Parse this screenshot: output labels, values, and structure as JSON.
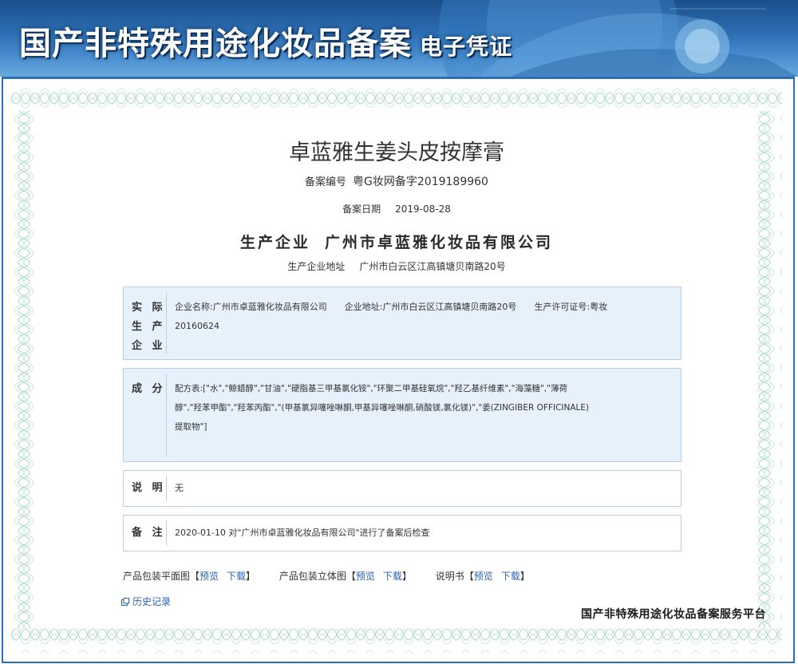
{
  "banner": {
    "title": "国产非特殊用途化妆品备案",
    "subtitle": "电子凭证"
  },
  "product": {
    "name": "卓蓝雅生姜头皮按摩膏",
    "record_no_label": "备案编号",
    "record_no": "粤G妆网备字2019189960",
    "record_date_label": "备案日期",
    "record_date": "2019-08-28",
    "producer_label": "生产企业",
    "producer": "广州市卓蓝雅化妆品有限公司",
    "producer_addr_label": "生产企业地址",
    "producer_addr": "广州市白云区江高镇塘贝南路20号"
  },
  "actual_producer": {
    "label": "实际生产企业",
    "label_lines": [
      "实 际",
      "生 产",
      "企 业"
    ],
    "name_label": "企业名称:",
    "name": "广州市卓蓝雅化妆品有限公司",
    "addr_label": "企业地址:",
    "addr": "广州市白云区江高镇塘贝南路20号",
    "license_label": "生产许可证号:",
    "license": "粤妆",
    "license_cont": "20160624"
  },
  "ingredients": {
    "label": "成 分",
    "line1": "配方表:[\"水\",\"鲸蜡醇\",\"甘油\",\"硬脂基三甲基氯化铵\",\"环聚二甲基硅氧烷\",\"羟乙基纤维素\",\"海藻糖\",\"薄荷",
    "line2": "醇\",\"羟苯甲酯\",\"羟苯丙酯\",\"(甲基氯异噻唑啉酮,甲基异噻唑啉酮,硝酸镁,氯化镁)\",\"姜(ZINGIBER OFFICINALE)",
    "line3": "提取物\"]"
  },
  "note": {
    "label": "说 明",
    "text": "无"
  },
  "remark": {
    "label": "备 注",
    "text": "2020-01-10 对\"广州市卓蓝雅化妆品有限公司\"进行了备案后检查"
  },
  "links": {
    "flat_label": "产品包装平面图【",
    "flat_preview": "预览",
    "flat_download": "下载",
    "close": "】",
    "stereo_label": "产品包装立体图【",
    "stereo_preview": "预览",
    "stereo_download": "下载",
    "manual_label": "说明书【",
    "manual_preview": "预览",
    "manual_download": "下载"
  },
  "history": {
    "label": "历史记录",
    "icon": "external-link-icon"
  },
  "platform": "国产非特殊用途化妆品备案服务平台",
  "colors": {
    "banner_blue": "#1b4f8c",
    "frame_blue": "#2d6fb4",
    "box_blue": "#e7f1fc",
    "box_border": "#b8cfe6",
    "link": "#2a62b0",
    "guilloche": "#8fd2b4"
  }
}
